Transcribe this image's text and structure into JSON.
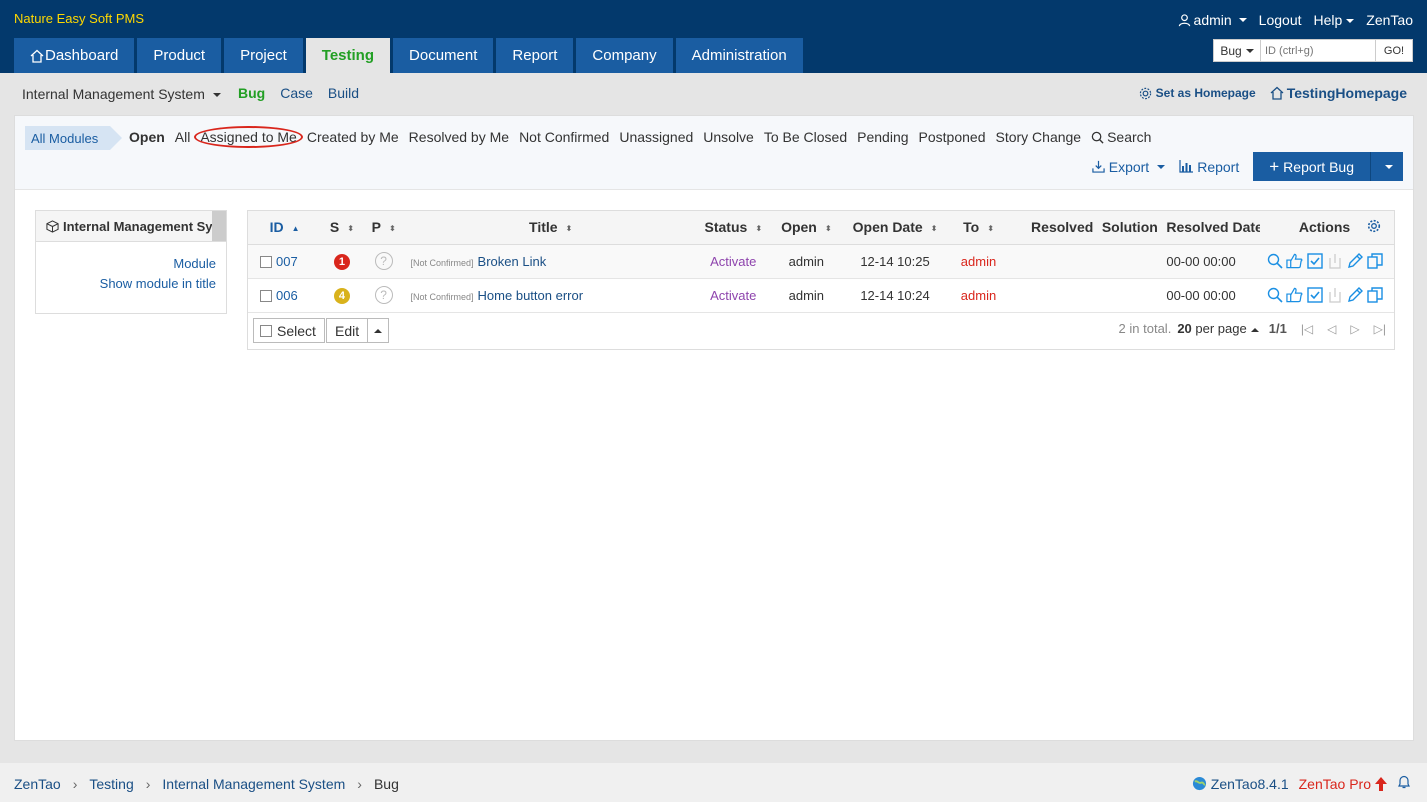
{
  "brand": "Nature Easy Soft PMS",
  "topbar": {
    "user": "admin",
    "logout": "Logout",
    "help": "Help",
    "zentao": "ZenTao"
  },
  "mainnav": [
    {
      "label": "Dashboard"
    },
    {
      "label": "Product"
    },
    {
      "label": "Project"
    },
    {
      "label": "Testing"
    },
    {
      "label": "Document"
    },
    {
      "label": "Report"
    },
    {
      "label": "Company"
    },
    {
      "label": "Administration"
    }
  ],
  "quicksearch": {
    "type": "Bug",
    "placeholder": "ID (ctrl+g)",
    "go": "GO!"
  },
  "subnav": {
    "product": "Internal Management System",
    "items": [
      "Bug",
      "Case",
      "Build"
    ],
    "set_homepage": "Set as Homepage",
    "testing_homepage": "TestingHomepage"
  },
  "featurebar": {
    "all_modules": "All Modules",
    "filters": [
      "Open",
      "All",
      "Assigned to Me",
      "Created by Me",
      "Resolved by Me",
      "Not Confirmed",
      "Unassigned",
      "Unsolve",
      "To Be Closed",
      "Pending",
      "Postponed",
      "Story Change"
    ],
    "search": "Search",
    "export": "Export",
    "report": "Report",
    "report_bug": "Report Bug"
  },
  "side": {
    "title": "Internal Management System",
    "module_link": "Module",
    "show_module_link": "Show module in title"
  },
  "table": {
    "columns": [
      "ID",
      "S",
      "P",
      "Title",
      "Status",
      "Open",
      "Open Date",
      "To",
      "Resolved",
      "Solution",
      "Resolved Date",
      "Actions"
    ],
    "rows": [
      {
        "id": "007",
        "severity": "1",
        "severity_color": "#d9261c",
        "priority": "?",
        "tag": "[Not Confirmed]",
        "title": "Broken Link",
        "status": "Activate",
        "open": "admin",
        "open_date": "12-14 10:25",
        "to": "admin",
        "resolved": "",
        "solution": "",
        "resolved_date": "00-00 00:00"
      },
      {
        "id": "006",
        "severity": "4",
        "severity_color": "#d9b21c",
        "priority": "?",
        "tag": "[Not Confirmed]",
        "title": "Home button error",
        "status": "Activate",
        "open": "admin",
        "open_date": "12-14 10:24",
        "to": "admin",
        "resolved": "",
        "solution": "",
        "resolved_date": "00-00 00:00"
      }
    ],
    "select": "Select",
    "edit": "Edit",
    "pager": {
      "total": "2 in total.",
      "per_page_num": "20",
      "per_page_label": "per page",
      "page": "1/1"
    }
  },
  "footer": {
    "breadcrumb": [
      "ZenTao",
      "Testing",
      "Internal Management System",
      "Bug"
    ],
    "version": "ZenTao8.4.1",
    "pro": "ZenTao Pro"
  }
}
